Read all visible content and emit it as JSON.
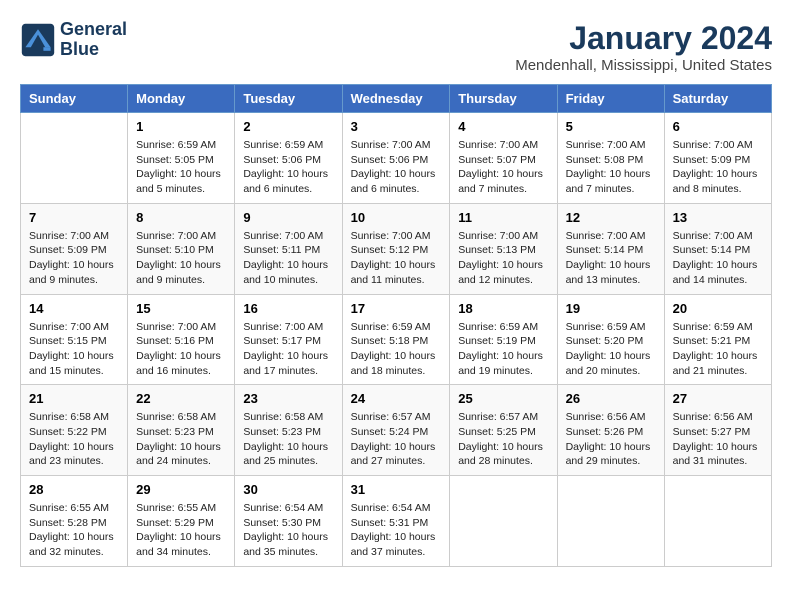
{
  "header": {
    "logo_line1": "General",
    "logo_line2": "Blue",
    "month_year": "January 2024",
    "location": "Mendenhall, Mississippi, United States"
  },
  "columns": [
    "Sunday",
    "Monday",
    "Tuesday",
    "Wednesday",
    "Thursday",
    "Friday",
    "Saturday"
  ],
  "weeks": [
    [
      {
        "day": "",
        "content": ""
      },
      {
        "day": "1",
        "content": "Sunrise: 6:59 AM\nSunset: 5:05 PM\nDaylight: 10 hours\nand 5 minutes."
      },
      {
        "day": "2",
        "content": "Sunrise: 6:59 AM\nSunset: 5:06 PM\nDaylight: 10 hours\nand 6 minutes."
      },
      {
        "day": "3",
        "content": "Sunrise: 7:00 AM\nSunset: 5:06 PM\nDaylight: 10 hours\nand 6 minutes."
      },
      {
        "day": "4",
        "content": "Sunrise: 7:00 AM\nSunset: 5:07 PM\nDaylight: 10 hours\nand 7 minutes."
      },
      {
        "day": "5",
        "content": "Sunrise: 7:00 AM\nSunset: 5:08 PM\nDaylight: 10 hours\nand 7 minutes."
      },
      {
        "day": "6",
        "content": "Sunrise: 7:00 AM\nSunset: 5:09 PM\nDaylight: 10 hours\nand 8 minutes."
      }
    ],
    [
      {
        "day": "7",
        "content": "Sunrise: 7:00 AM\nSunset: 5:09 PM\nDaylight: 10 hours\nand 9 minutes."
      },
      {
        "day": "8",
        "content": "Sunrise: 7:00 AM\nSunset: 5:10 PM\nDaylight: 10 hours\nand 9 minutes."
      },
      {
        "day": "9",
        "content": "Sunrise: 7:00 AM\nSunset: 5:11 PM\nDaylight: 10 hours\nand 10 minutes."
      },
      {
        "day": "10",
        "content": "Sunrise: 7:00 AM\nSunset: 5:12 PM\nDaylight: 10 hours\nand 11 minutes."
      },
      {
        "day": "11",
        "content": "Sunrise: 7:00 AM\nSunset: 5:13 PM\nDaylight: 10 hours\nand 12 minutes."
      },
      {
        "day": "12",
        "content": "Sunrise: 7:00 AM\nSunset: 5:14 PM\nDaylight: 10 hours\nand 13 minutes."
      },
      {
        "day": "13",
        "content": "Sunrise: 7:00 AM\nSunset: 5:14 PM\nDaylight: 10 hours\nand 14 minutes."
      }
    ],
    [
      {
        "day": "14",
        "content": "Sunrise: 7:00 AM\nSunset: 5:15 PM\nDaylight: 10 hours\nand 15 minutes."
      },
      {
        "day": "15",
        "content": "Sunrise: 7:00 AM\nSunset: 5:16 PM\nDaylight: 10 hours\nand 16 minutes."
      },
      {
        "day": "16",
        "content": "Sunrise: 7:00 AM\nSunset: 5:17 PM\nDaylight: 10 hours\nand 17 minutes."
      },
      {
        "day": "17",
        "content": "Sunrise: 6:59 AM\nSunset: 5:18 PM\nDaylight: 10 hours\nand 18 minutes."
      },
      {
        "day": "18",
        "content": "Sunrise: 6:59 AM\nSunset: 5:19 PM\nDaylight: 10 hours\nand 19 minutes."
      },
      {
        "day": "19",
        "content": "Sunrise: 6:59 AM\nSunset: 5:20 PM\nDaylight: 10 hours\nand 20 minutes."
      },
      {
        "day": "20",
        "content": "Sunrise: 6:59 AM\nSunset: 5:21 PM\nDaylight: 10 hours\nand 21 minutes."
      }
    ],
    [
      {
        "day": "21",
        "content": "Sunrise: 6:58 AM\nSunset: 5:22 PM\nDaylight: 10 hours\nand 23 minutes."
      },
      {
        "day": "22",
        "content": "Sunrise: 6:58 AM\nSunset: 5:23 PM\nDaylight: 10 hours\nand 24 minutes."
      },
      {
        "day": "23",
        "content": "Sunrise: 6:58 AM\nSunset: 5:23 PM\nDaylight: 10 hours\nand 25 minutes."
      },
      {
        "day": "24",
        "content": "Sunrise: 6:57 AM\nSunset: 5:24 PM\nDaylight: 10 hours\nand 27 minutes."
      },
      {
        "day": "25",
        "content": "Sunrise: 6:57 AM\nSunset: 5:25 PM\nDaylight: 10 hours\nand 28 minutes."
      },
      {
        "day": "26",
        "content": "Sunrise: 6:56 AM\nSunset: 5:26 PM\nDaylight: 10 hours\nand 29 minutes."
      },
      {
        "day": "27",
        "content": "Sunrise: 6:56 AM\nSunset: 5:27 PM\nDaylight: 10 hours\nand 31 minutes."
      }
    ],
    [
      {
        "day": "28",
        "content": "Sunrise: 6:55 AM\nSunset: 5:28 PM\nDaylight: 10 hours\nand 32 minutes."
      },
      {
        "day": "29",
        "content": "Sunrise: 6:55 AM\nSunset: 5:29 PM\nDaylight: 10 hours\nand 34 minutes."
      },
      {
        "day": "30",
        "content": "Sunrise: 6:54 AM\nSunset: 5:30 PM\nDaylight: 10 hours\nand 35 minutes."
      },
      {
        "day": "31",
        "content": "Sunrise: 6:54 AM\nSunset: 5:31 PM\nDaylight: 10 hours\nand 37 minutes."
      },
      {
        "day": "",
        "content": ""
      },
      {
        "day": "",
        "content": ""
      },
      {
        "day": "",
        "content": ""
      }
    ]
  ]
}
